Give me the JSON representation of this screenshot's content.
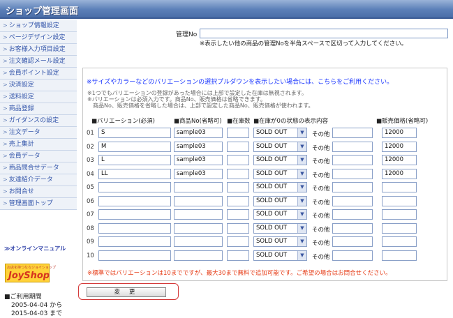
{
  "title": "ショップ管理画面",
  "menu": [
    "ショップ情報設定",
    "ページデザイン設定",
    "お客様入力項目設定",
    "注文確認メール設定",
    "会員ポイント設定",
    "決済設定",
    "送料設定",
    "商品登録",
    "ガイダンスの設定",
    "注文データ",
    "売上集計",
    "会員データ",
    "商品問合せデータ",
    "友達紹介データ",
    "お問合せ",
    "管理画面トップ"
  ],
  "manual_link": "≫オンラインマニュアル",
  "logo": {
    "small": "お店を持つならジョイショップ",
    "big": "JoyShop"
  },
  "period": {
    "label": "■ご利用期間",
    "from": "2005-04-04 から",
    "to": "2015-04-03 まで"
  },
  "management": {
    "label": "管理No",
    "value": "",
    "note": "※表示したい他の商品の管理Noを半角スペースで区切って入力してください。"
  },
  "variation": {
    "title": "※サイズやカラーなどのバリエーションの選択プルダウンを表示したい場合には、こちらをご利用ください。",
    "notes": [
      "※1つでもバリエーションの登録があった場合には上部で設定した在庫は無視されます。",
      "※バリエーションは必須入力です。商品No、販売価格は省略できます。",
      "　商品No、販売価格を省略した場合は、上部で設定した商品No、販売価格が使われます。"
    ],
    "headers": {
      "variation": "■バリエーション(必須)",
      "item_no": "■商品No(省略可)",
      "stock": "■在庫数",
      "zero_display": "■在庫が0の状態の表示内容",
      "price": "■販売価格(省略可)"
    },
    "other_label": "その他",
    "rows": [
      {
        "no": "01",
        "name": "S",
        "item_no": "sample03",
        "stock": "",
        "status": "SOLD OUT",
        "other": "",
        "price": "12000"
      },
      {
        "no": "02",
        "name": "M",
        "item_no": "sample03",
        "stock": "",
        "status": "SOLD OUT",
        "other": "",
        "price": "12000"
      },
      {
        "no": "03",
        "name": "L",
        "item_no": "sample03",
        "stock": "",
        "status": "SOLD OUT",
        "other": "",
        "price": "12000"
      },
      {
        "no": "04",
        "name": "LL",
        "item_no": "sample03",
        "stock": "",
        "status": "SOLD OUT",
        "other": "",
        "price": "12000"
      },
      {
        "no": "05",
        "name": "",
        "item_no": "",
        "stock": "",
        "status": "SOLD OUT",
        "other": "",
        "price": ""
      },
      {
        "no": "06",
        "name": "",
        "item_no": "",
        "stock": "",
        "status": "SOLD OUT",
        "other": "",
        "price": ""
      },
      {
        "no": "07",
        "name": "",
        "item_no": "",
        "stock": "",
        "status": "SOLD OUT",
        "other": "",
        "price": ""
      },
      {
        "no": "08",
        "name": "",
        "item_no": "",
        "stock": "",
        "status": "SOLD OUT",
        "other": "",
        "price": ""
      },
      {
        "no": "09",
        "name": "",
        "item_no": "",
        "stock": "",
        "status": "SOLD OUT",
        "other": "",
        "price": ""
      },
      {
        "no": "10",
        "name": "",
        "item_no": "",
        "stock": "",
        "status": "SOLD OUT",
        "other": "",
        "price": ""
      }
    ],
    "footnote": "※標準ではバリエーションは10までですが、最大30まで無料で追加可能です。ご希望の場合はお問合せください。"
  },
  "submit_label": "変 更",
  "colors": {
    "title_bar": "#5b7fb8",
    "link": "#1a36ff",
    "warning": "#e63a14"
  }
}
